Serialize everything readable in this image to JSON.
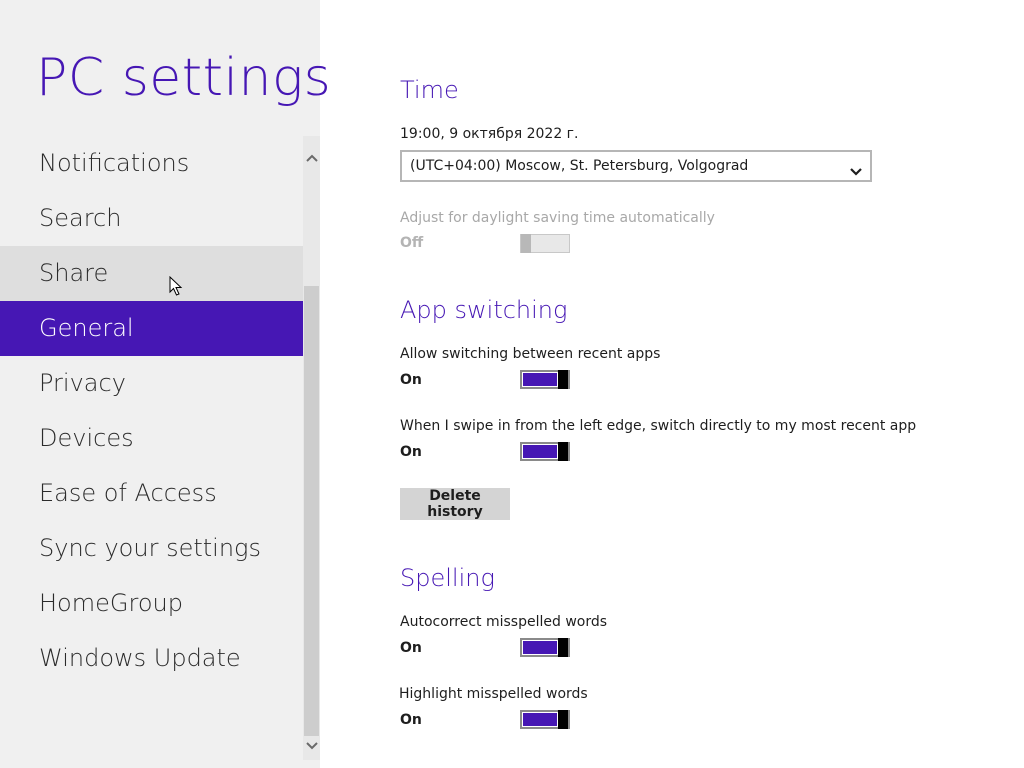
{
  "app": {
    "title": "PC settings"
  },
  "sidebar": {
    "items": [
      {
        "label": "Notifications"
      },
      {
        "label": "Search"
      },
      {
        "label": "Share",
        "state": "hover"
      },
      {
        "label": "General",
        "state": "selected"
      },
      {
        "label": "Privacy"
      },
      {
        "label": "Devices"
      },
      {
        "label": "Ease of Access"
      },
      {
        "label": "Sync your settings"
      },
      {
        "label": "HomeGroup"
      },
      {
        "label": "Windows Update"
      }
    ]
  },
  "time": {
    "title": "Time",
    "current": "19:00, 9 октября 2022 г.",
    "timezone": "(UTC+04:00) Moscow, St. Petersburg, Volgograd",
    "daylight_label": "Adjust for daylight saving time automatically",
    "daylight_state": "Off"
  },
  "app_switching": {
    "title": "App switching",
    "allow_label": "Allow switching between recent apps",
    "allow_state": "On",
    "swipe_label": "When I swipe in from the left edge, switch directly to my most recent app",
    "swipe_state": "On",
    "delete_button": "Delete history"
  },
  "spelling": {
    "title": "Spelling",
    "autocorrect_label": "Autocorrect misspelled words",
    "autocorrect_state": "On",
    "highlight_label": "Highlight misspelled words",
    "highlight_state": "On"
  },
  "colors": {
    "accent": "#4617b4",
    "sidebar_bg": "#f0f0f0",
    "hover_bg": "#dedede"
  },
  "icons": {
    "scroll_up": "chevron-up-icon",
    "scroll_down": "chevron-down-icon",
    "dropdown": "chevron-down-icon",
    "cursor": "mouse-pointer-icon"
  }
}
